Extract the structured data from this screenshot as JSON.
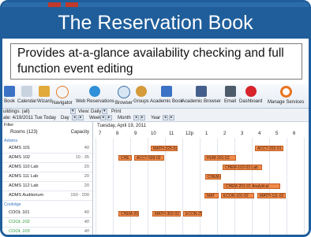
{
  "header": {
    "title": "The Reservation Book"
  },
  "caption": {
    "text": "Provides at-a-glance availability checking and full function event editing"
  },
  "toolbar": {
    "items": [
      "Book",
      "Calendar",
      "Wizard",
      "Navigator",
      "Web Reservations",
      "Browser",
      "Groups",
      "Academic Book",
      "Academic Browser",
      "Email",
      "Dashboard",
      "Manage Services"
    ]
  },
  "controls": {
    "building": "uildings: (all)",
    "view_label": "View:",
    "view_value": "Daily",
    "print": "Print",
    "date_label": "ate: 4/19/2011 Tue",
    "today": "Today",
    "day": "Day",
    "week": "Week",
    "month": "Month",
    "year": "Year"
  },
  "rooms_panel": {
    "filter": "Filter",
    "col_room": "Rooms (123)",
    "col_capacity": "Capacity",
    "sections": [
      {
        "name": "Adams"
      },
      {
        "name": "Coolidge"
      }
    ],
    "rooms": [
      {
        "name": "ADMS 101",
        "capacity": "40"
      },
      {
        "name": "ADMS 102",
        "capacity": "10 - 35"
      },
      {
        "name": "ADMS 110 Lab",
        "capacity": "20"
      },
      {
        "name": "ADMS 111 Lab",
        "capacity": "20"
      },
      {
        "name": "ADMS 112 Lab",
        "capacity": "20"
      },
      {
        "name": "ADMS Auditorium",
        "capacity": "150 - 200"
      },
      {
        "name": "COOL 101",
        "capacity": "40"
      },
      {
        "name": "COOL 102",
        "capacity": "40"
      },
      {
        "name": "COOL 103",
        "capacity": "40"
      }
    ]
  },
  "schedule": {
    "date": "Tuesday, April 19, 2011",
    "hours": [
      "7",
      "8",
      "9",
      "10",
      "11",
      "12p",
      "1",
      "2",
      "3",
      "4",
      "5",
      "6"
    ],
    "events": [
      {
        "label": "MATH-225-02",
        "row": 0
      },
      {
        "label": "ACCT-202-01",
        "row": 0
      },
      {
        "label": "CHE",
        "row": 1
      },
      {
        "label": "ACCT-509-02",
        "row": 1
      },
      {
        "label": "HUM-201-02",
        "row": 1
      },
      {
        "label": "CHEM-102-03 Lab",
        "row": 2
      },
      {
        "label": "CHEM-10",
        "row": 3
      },
      {
        "label": "CHEM-201-01 Analytical",
        "row": 4
      },
      {
        "label": "MAT",
        "row": 5
      },
      {
        "label": "ECON-101-02",
        "row": 5
      },
      {
        "label": "MATH-111-02",
        "row": 5
      },
      {
        "label": "CHEM-20",
        "row": 6
      },
      {
        "label": "MATH-302-02",
        "row": 6
      },
      {
        "label": "ECON-250",
        "row": 6
      }
    ]
  },
  "colors": {
    "brand": "#1f5e9b",
    "event": "#ef8a4b",
    "section": "#3a78c2"
  }
}
